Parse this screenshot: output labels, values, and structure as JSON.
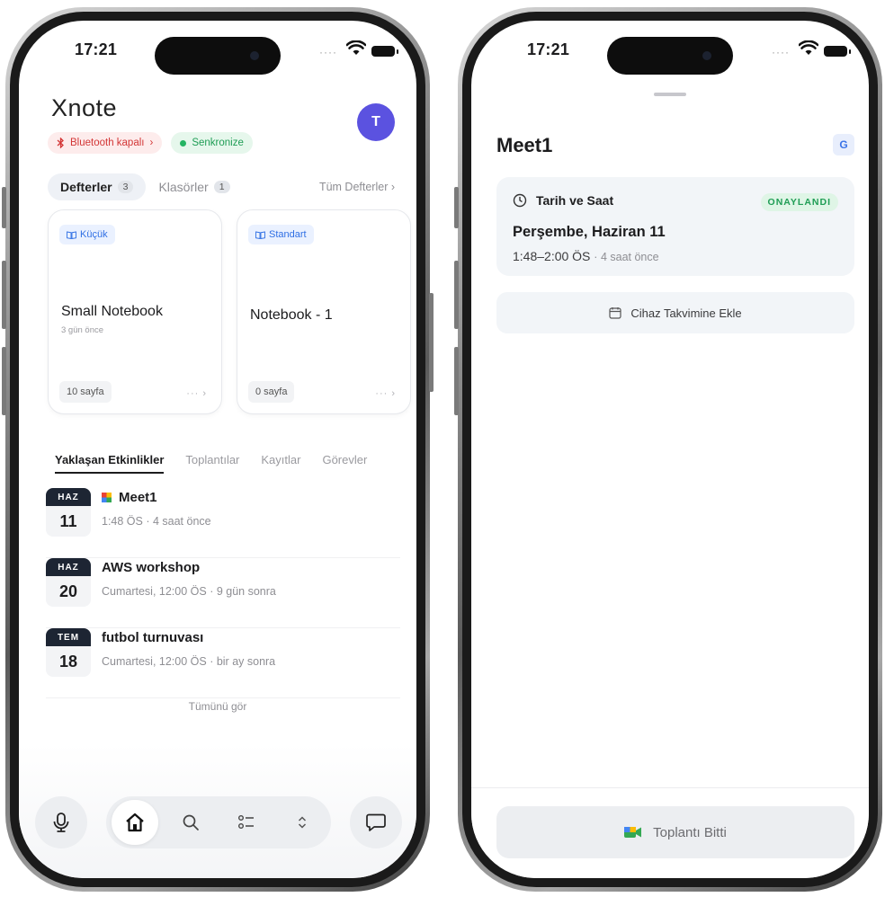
{
  "status_bar": {
    "time": "17:21"
  },
  "home": {
    "logo": "Xnote",
    "avatar_initial": "T",
    "bluetooth_badge": "Bluetooth kapalı",
    "bluetooth_chevron": "›",
    "sync_badge": "Senkronize",
    "notebook_tabs": [
      {
        "label": "Defterler",
        "count": "3"
      },
      {
        "label": "Klasörler",
        "count": "1"
      }
    ],
    "all_notebooks_link": "Tüm Defterler ›",
    "notebooks": [
      {
        "type_chip": "Küçük",
        "title": "Small Notebook",
        "subtitle": "3 gün önce",
        "pages": "10 sayfa",
        "actions": "··· ›"
      },
      {
        "type_chip": "Standart",
        "title": "Notebook - 1",
        "subtitle": "",
        "pages": "0 sayfa",
        "actions": "··· ›"
      }
    ],
    "event_tabs": [
      "Yaklaşan Etkinlikler",
      "Toplantılar",
      "Kayıtlar",
      "Görevler"
    ],
    "events": [
      {
        "month": "HAZ",
        "day": "11",
        "title": "Meet1",
        "subtitle": "1:48 ÖS · 4 saat önce",
        "has_meet_icon": true
      },
      {
        "month": "HAZ",
        "day": "20",
        "title": "AWS workshop",
        "subtitle": "Cumartesi, 12:00 ÖS · 9 gün sonra",
        "has_meet_icon": false
      },
      {
        "month": "TEM",
        "day": "18",
        "title": "futbol turnuvası",
        "subtitle": "Cumartesi, 12:00 ÖS · bir ay sonra",
        "has_meet_icon": false
      }
    ],
    "see_all": "Tümünü gör",
    "bottom_nav": [
      "mic-icon",
      "home-icon",
      "search-icon",
      "tasks-icon",
      "expand-icon",
      "chat-icon"
    ]
  },
  "meeting": {
    "title": "Meet1",
    "provider_badge": "G",
    "section_label": "Tarih ve Saat",
    "status": "ONAYLANDI",
    "date": "Perşembe, Haziran 11",
    "time_range": "1:48–2:00 ÖS",
    "relative": "4 saat önce",
    "add_to_calendar": "Cihaz Takvimine Ekle",
    "end_meeting": "Toplantı Bitti"
  },
  "colors": {
    "accent": "#5b52e0",
    "success": "#1f9d55",
    "danger": "#d33636",
    "link_blue": "#2f6fe4",
    "dark_navy": "#1d2533"
  }
}
